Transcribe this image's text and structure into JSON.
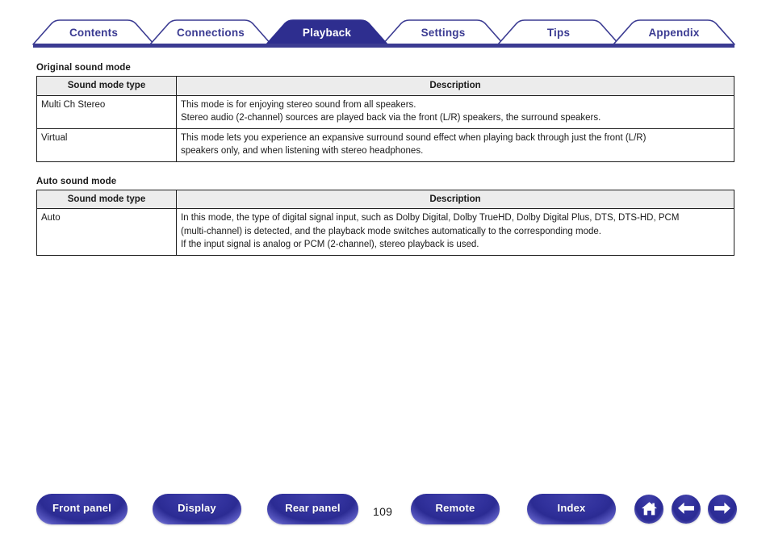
{
  "nav": {
    "tabs": [
      {
        "label": "Contents",
        "active": false
      },
      {
        "label": "Connections",
        "active": false
      },
      {
        "label": "Playback",
        "active": true
      },
      {
        "label": "Settings",
        "active": false
      },
      {
        "label": "Tips",
        "active": false
      },
      {
        "label": "Appendix",
        "active": false
      }
    ],
    "accent_color": "#3b3b92",
    "active_tab_fill": "#2e2e8f",
    "active_tab_text": "#ffffff",
    "inactive_tab_text": "#3b3b92"
  },
  "main": {
    "sections": [
      {
        "title": "Original sound mode",
        "headers": [
          "Sound mode type",
          "Description"
        ],
        "rows": [
          {
            "type": "Multi Ch Stereo",
            "description_lines": [
              "This mode is for enjoying stereo sound from all speakers.",
              "Stereo audio (2-channel) sources are played back via the front (L/R) speakers, the surround speakers."
            ]
          },
          {
            "type": "Virtual",
            "description_lines": [
              "This mode lets you experience an expansive surround sound effect when playing back through just the front (L/R)",
              "speakers only, and when listening with stereo headphones."
            ]
          }
        ]
      },
      {
        "title": "Auto sound mode",
        "headers": [
          "Sound mode type",
          "Description"
        ],
        "rows": [
          {
            "type": "Auto",
            "description_lines": [
              "In this mode, the type of digital signal input, such as Dolby Digital, Dolby TrueHD, Dolby Digital Plus, DTS, DTS-HD, PCM",
              "(multi-channel) is detected, and the playback mode switches automatically to the corresponding mode.",
              "If the input signal is analog or PCM (2-channel), stereo playback is used."
            ]
          }
        ]
      }
    ],
    "header_background": "#ececec",
    "border_color": "#1f1f1f"
  },
  "footer": {
    "buttons": [
      {
        "label": "Front panel",
        "name": "front-panel-button"
      },
      {
        "label": "Display",
        "name": "display-button"
      },
      {
        "label": "Rear panel",
        "name": "rear-panel-button"
      },
      {
        "label": "Remote",
        "name": "remote-button"
      },
      {
        "label": "Index",
        "name": "index-button"
      }
    ],
    "icons": [
      {
        "name": "home-icon"
      },
      {
        "name": "arrow-left-icon"
      },
      {
        "name": "arrow-right-icon"
      }
    ],
    "page_number": "109",
    "button_color": "#2b2b93"
  }
}
